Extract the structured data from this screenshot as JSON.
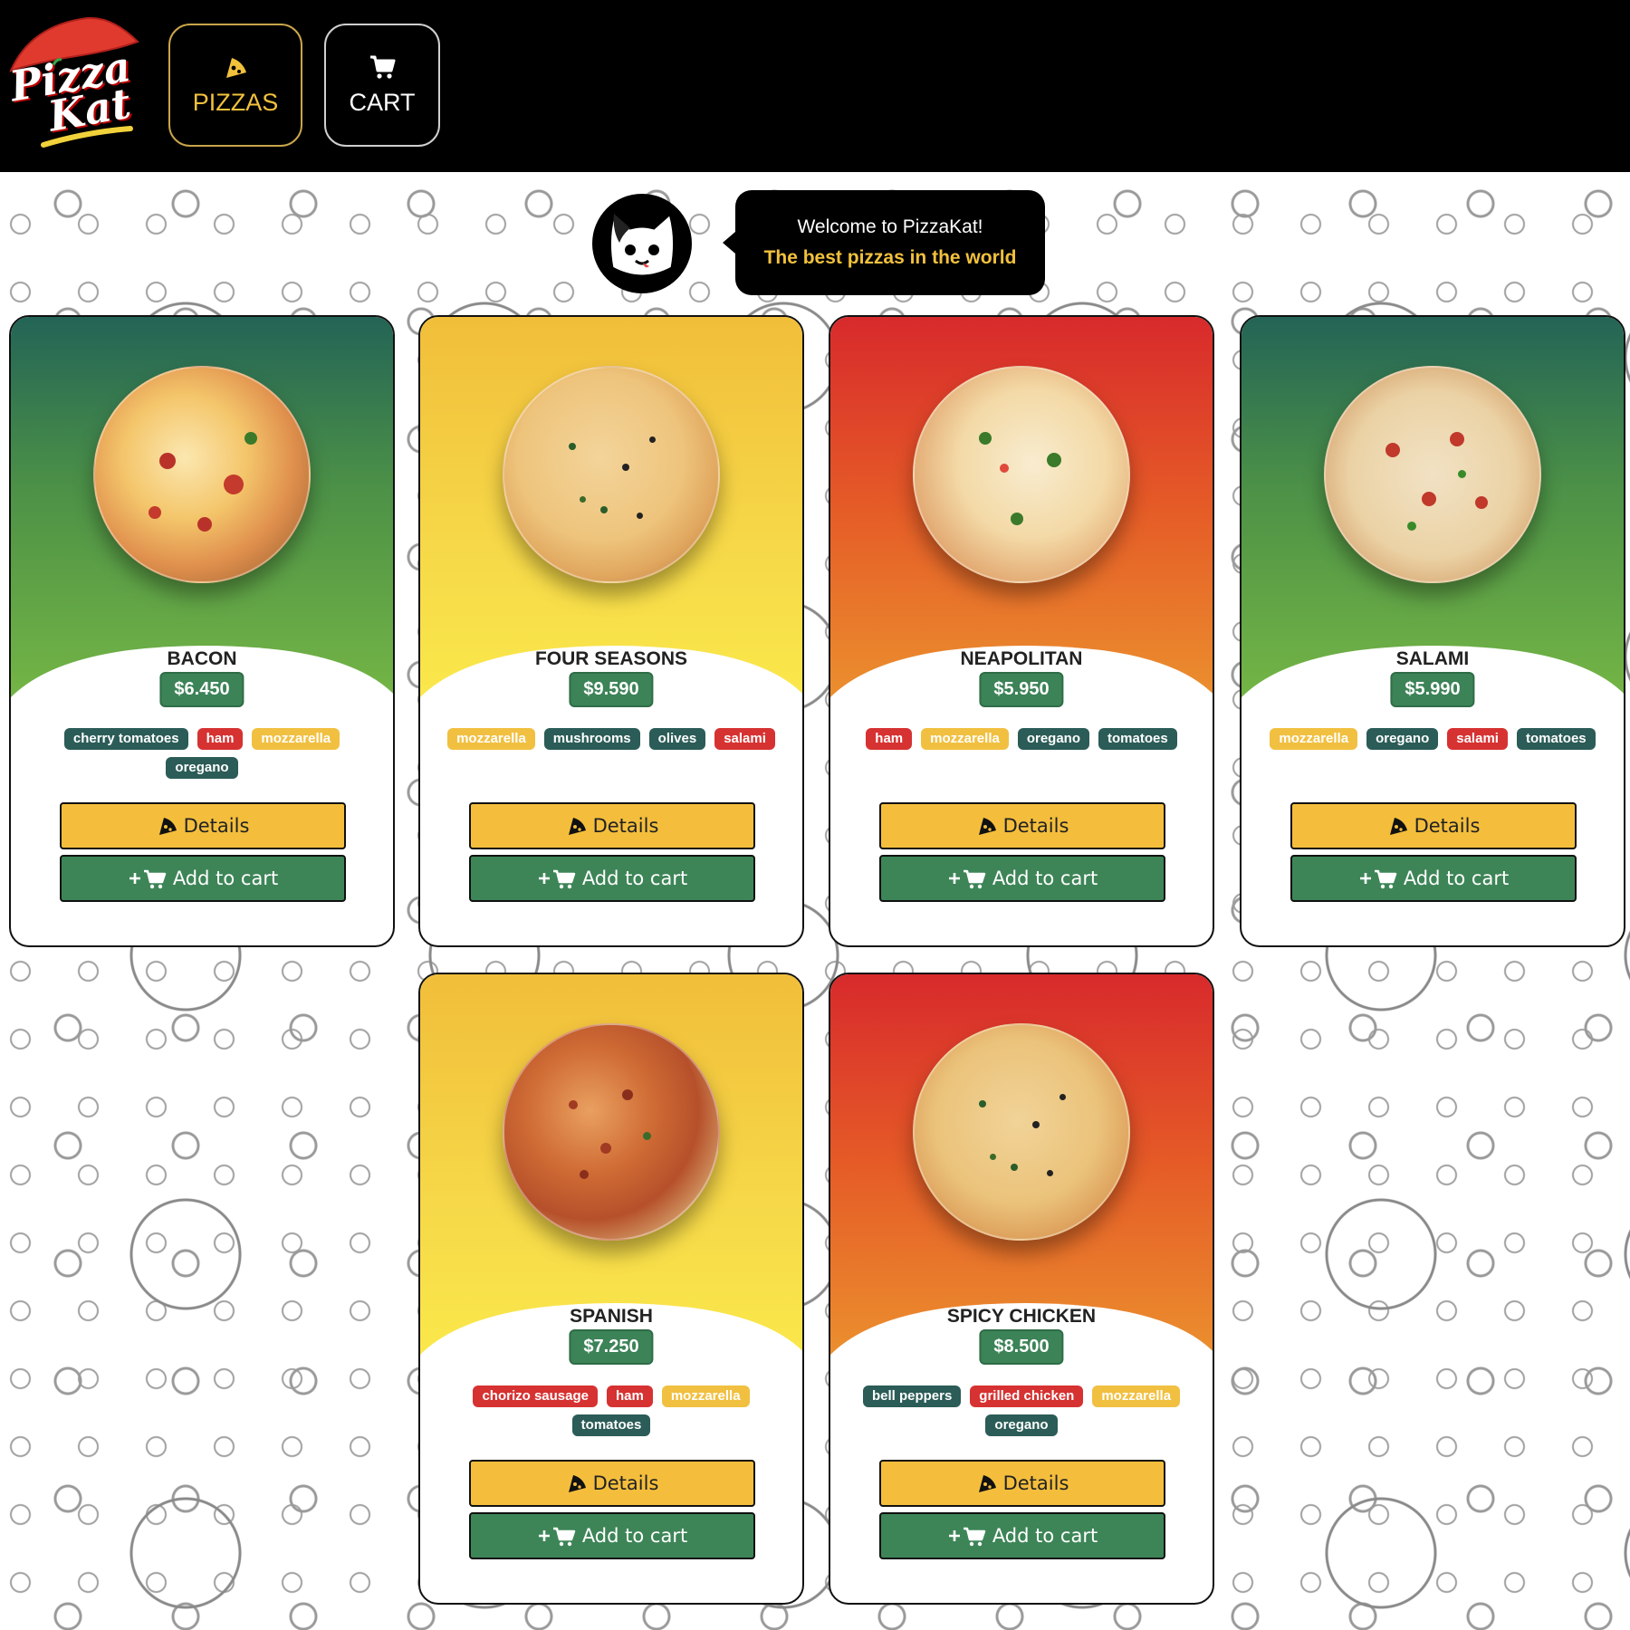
{
  "app": {
    "logo_text_line1": "Pizza",
    "logo_text_line2": "Kat"
  },
  "nav": {
    "pizzas_label": "PIZZAS",
    "pizzas_icon": "pizza-slice-icon",
    "cart_label": "CART",
    "cart_icon": "cart-icon"
  },
  "welcome": {
    "line1": "Welcome to PizzaKat!",
    "line2": "The best pizzas in the world",
    "avatar_icon": "cat-face-icon"
  },
  "buttons": {
    "details_label": "Details",
    "add_to_cart_label": "Add to cart"
  },
  "colors": {
    "header_bg": "#000000",
    "accent_yellow": "#f4be3c",
    "accent_green": "#3d8557",
    "tag_green": "#2b5c57",
    "tag_red": "#d63232",
    "tag_yellow": "#f1c041"
  },
  "pizzas": [
    {
      "name": "BACON",
      "price": "$6.450",
      "theme": "green",
      "ingredients": [
        {
          "label": "cherry tomatoes",
          "color": "green"
        },
        {
          "label": "ham",
          "color": "red"
        },
        {
          "label": "mozzarella",
          "color": "yellow"
        },
        {
          "label": "oregano",
          "color": "green"
        }
      ]
    },
    {
      "name": "FOUR SEASONS",
      "price": "$9.590",
      "theme": "yellow",
      "ingredients": [
        {
          "label": "mozzarella",
          "color": "yellow"
        },
        {
          "label": "mushrooms",
          "color": "green"
        },
        {
          "label": "olives",
          "color": "green"
        },
        {
          "label": "salami",
          "color": "red"
        }
      ]
    },
    {
      "name": "NEAPOLITAN",
      "price": "$5.950",
      "theme": "red",
      "ingredients": [
        {
          "label": "ham",
          "color": "red"
        },
        {
          "label": "mozzarella",
          "color": "yellow"
        },
        {
          "label": "oregano",
          "color": "green"
        },
        {
          "label": "tomatoes",
          "color": "green"
        }
      ]
    },
    {
      "name": "SALAMI",
      "price": "$5.990",
      "theme": "green",
      "ingredients": [
        {
          "label": "mozzarella",
          "color": "yellow"
        },
        {
          "label": "oregano",
          "color": "green"
        },
        {
          "label": "salami",
          "color": "red"
        },
        {
          "label": "tomatoes",
          "color": "green"
        }
      ]
    },
    {
      "name": "SPANISH",
      "price": "$7.250",
      "theme": "yellow",
      "ingredients": [
        {
          "label": "chorizo sausage",
          "color": "red"
        },
        {
          "label": "ham",
          "color": "red"
        },
        {
          "label": "mozzarella",
          "color": "yellow"
        },
        {
          "label": "tomatoes",
          "color": "green"
        }
      ]
    },
    {
      "name": "SPICY CHICKEN",
      "price": "$8.500",
      "theme": "red",
      "ingredients": [
        {
          "label": "bell peppers",
          "color": "green"
        },
        {
          "label": "grilled chicken",
          "color": "red"
        },
        {
          "label": "mozzarella",
          "color": "yellow"
        },
        {
          "label": "oregano",
          "color": "green"
        }
      ]
    }
  ]
}
